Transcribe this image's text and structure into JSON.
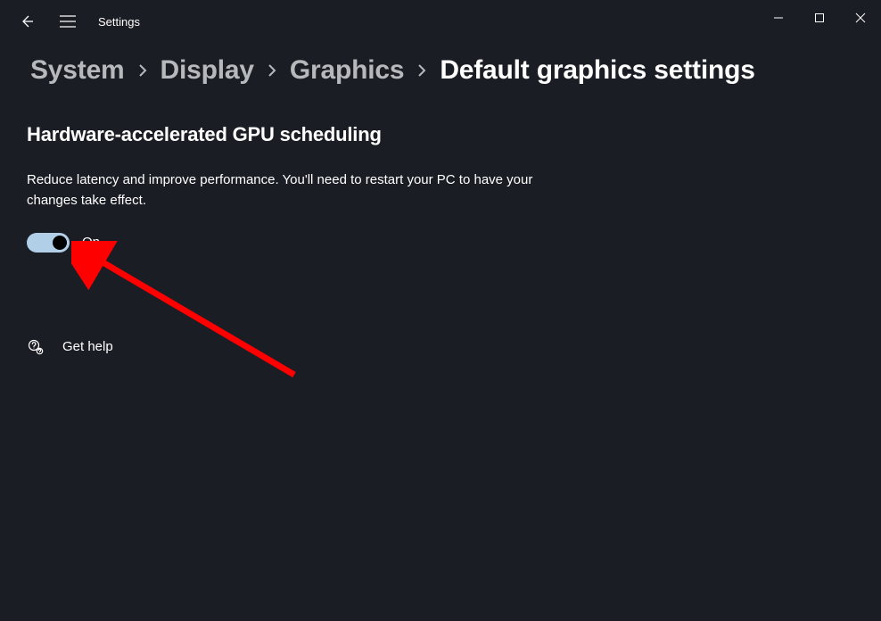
{
  "app": {
    "title": "Settings"
  },
  "breadcrumb": {
    "items": [
      {
        "label": "System"
      },
      {
        "label": "Display"
      },
      {
        "label": "Graphics"
      },
      {
        "label": "Default graphics settings"
      }
    ]
  },
  "section": {
    "title": "Hardware-accelerated GPU scheduling",
    "description": "Reduce latency and improve performance. You'll need to restart your PC to have your changes take effect.",
    "toggle_state": "On"
  },
  "help": {
    "label": "Get help"
  }
}
